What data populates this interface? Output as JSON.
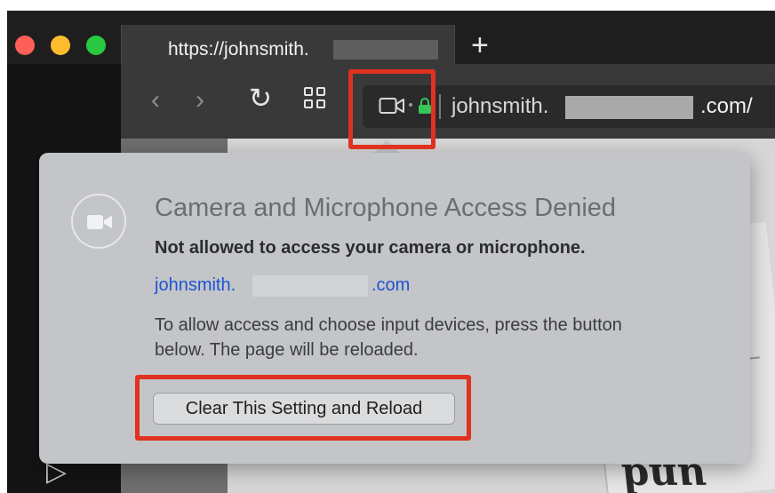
{
  "tab": {
    "title": "https://johnsmith.",
    "new_tab_label": "+"
  },
  "toolbar": {
    "back_glyph": "‹",
    "forward_glyph": "›",
    "reload_glyph": "↻"
  },
  "address_bar": {
    "host": "johnsmith.",
    "tld": ".com/",
    "camera_icon": "camera-blocked-icon",
    "lock_icon": "lock-icon"
  },
  "popover": {
    "icon": "camera-icon",
    "title": "Camera and Microphone Access Denied",
    "subtitle": "Not allowed to access your camera or microphone.",
    "site_prefix": "johnsmith.",
    "site_suffix": ".com",
    "body": "To allow access and choose input devices, press the button below. The page will be reloaded.",
    "button_label": "Clear This Setting and Reload"
  },
  "sidebar": {
    "arrow_glyph": "▷"
  },
  "colors": {
    "annotation": "#e0321f",
    "link": "#1f53d4",
    "lock": "#34c759"
  }
}
